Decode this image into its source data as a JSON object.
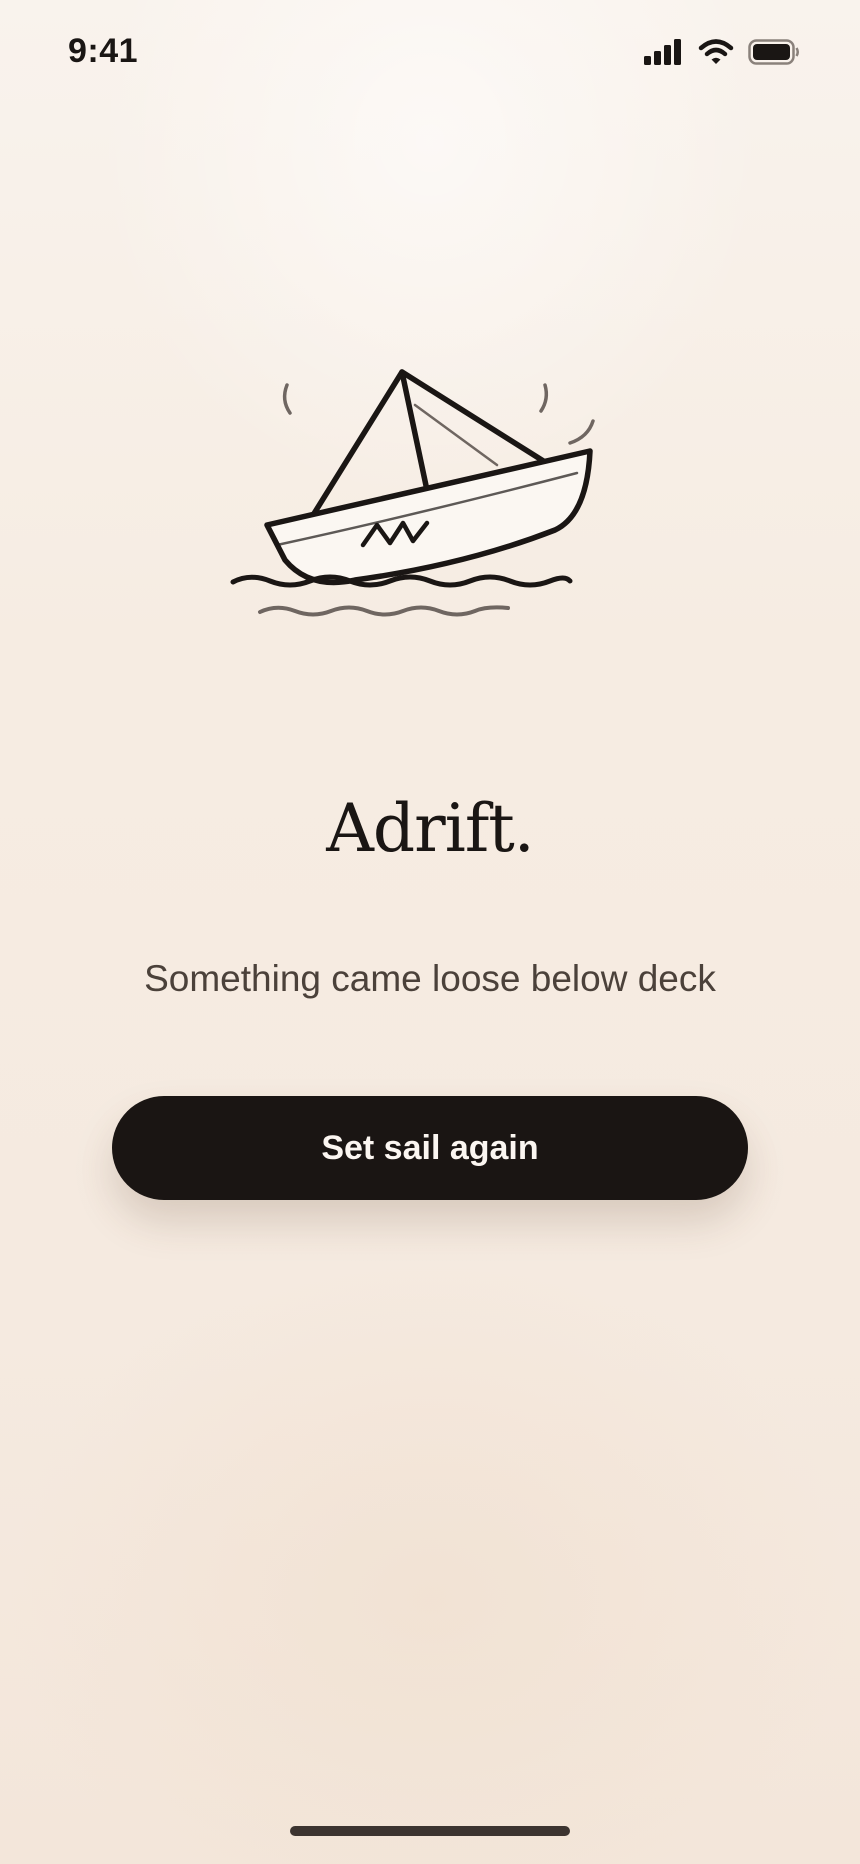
{
  "status_bar": {
    "time": "9:41",
    "signal_icon": "cellular-signal-icon",
    "wifi_icon": "wifi-icon",
    "battery_icon": "battery-icon"
  },
  "illustration": {
    "icon": "paper-boat-icon"
  },
  "error": {
    "title": "Adrift.",
    "message": "Something came loose below deck"
  },
  "actions": {
    "retry_label": "Set sail again"
  },
  "colors": {
    "background": "#f6ece2",
    "ink": "#1a1614",
    "button": "#1a1513",
    "button_text": "#fbf6f1",
    "muted_text": "#4b413a"
  }
}
